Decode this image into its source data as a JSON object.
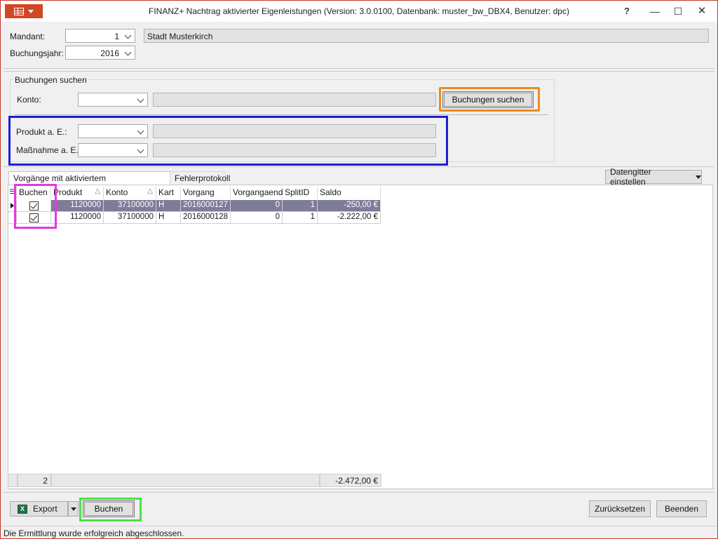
{
  "window": {
    "title": "FINANZ+ Nachtrag aktivierter Eigenleistungen (Version: 3.0.0100, Datenbank: muster_bw_DBX4, Benutzer: dpc)",
    "help_label": "?",
    "minimize_label": "—",
    "maximize_label": "☐",
    "close_label": "✕"
  },
  "header": {
    "mandant_label": "Mandant:",
    "mandant_value": "1",
    "mandant_name": "Stadt Musterkirch",
    "jahr_label": "Buchungsjahr:",
    "jahr_value": "2016"
  },
  "search": {
    "group_title": "Buchungen suchen",
    "konto_label": "Konto:",
    "konto_value": "",
    "konto_desc": "",
    "search_button": "Buchungen suchen",
    "produkt_label": "Produkt a. E.:",
    "produkt_value": "",
    "produkt_desc": "",
    "massnahme_label": "Maßnahme a. E.:",
    "massnahme_value": "",
    "massnahme_desc": ""
  },
  "tabs": [
    {
      "label": "Vorgänge mit aktiviertem Eigenleistungskonto",
      "active": true
    },
    {
      "label": "Fehlerprotokoll",
      "active": false
    }
  ],
  "grid_settings_label": "Datengitter einstellen",
  "grid": {
    "columns": [
      "Buchen",
      "Produkt",
      "Konto",
      "Kart",
      "Vorgang",
      "Vorgangaend",
      "SplitID",
      "Saldo"
    ],
    "sorted_indicator": "△",
    "rows": [
      {
        "buchen": true,
        "produkt": "1120000",
        "konto": "37100000",
        "kart": "H",
        "vorgang": "2016000127",
        "vorgangaend": "0",
        "splitid": "1",
        "saldo": "-250,00 €"
      },
      {
        "buchen": true,
        "produkt": "1120000",
        "konto": "37100000",
        "kart": "H",
        "vorgang": "2016000128",
        "vorgangaend": "0",
        "splitid": "1",
        "saldo": "-2.222,00 €"
      }
    ],
    "summary_count": "2",
    "summary_saldo": "-2.472,00 €"
  },
  "footer": {
    "export_label": "Export",
    "buchen_label": "Buchen",
    "reset_label": "Zurücksetzen",
    "exit_label": "Beenden"
  },
  "status": "Die Ermittlung wurde erfolgreich abgeschlossen."
}
